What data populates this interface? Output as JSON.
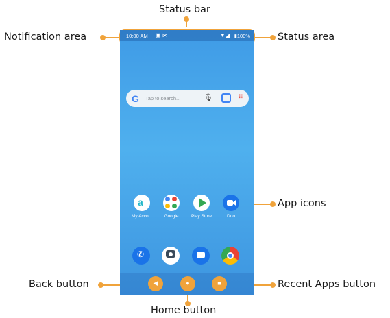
{
  "callouts": {
    "status_bar": "Status bar",
    "notification_area": "Notification area",
    "status_area": "Status area",
    "app_icons": "App icons",
    "back_button": "Back button",
    "home_button": "Home button",
    "recent_apps_button": "Recent Apps button"
  },
  "phone": {
    "status_time": "10:00 AM",
    "notification_icons": "▣ ⋈",
    "signal_icons": "▼◢",
    "battery": "▮100%",
    "search_placeholder": "Tap to search...",
    "apps": [
      {
        "label": "My Acco...",
        "icon": "account-a-icon",
        "color": "#ffffff"
      },
      {
        "label": "Google",
        "icon": "google-folder-icon",
        "color": "#ffffff"
      },
      {
        "label": "Play Store",
        "icon": "play-store-icon",
        "color": "#ffffff"
      },
      {
        "label": "Duo",
        "icon": "duo-video-icon",
        "color": "#1a73e8"
      }
    ],
    "dock": [
      {
        "icon": "phone-icon",
        "color": "#1a73e8"
      },
      {
        "icon": "camera-go-icon",
        "color": "#ffffff"
      },
      {
        "icon": "messages-icon",
        "color": "#1a73e8"
      },
      {
        "icon": "chrome-icon",
        "color": "#ffffff"
      }
    ]
  },
  "colors": {
    "accent": "#f0a33b",
    "wallpaper": "#49a7ec"
  }
}
